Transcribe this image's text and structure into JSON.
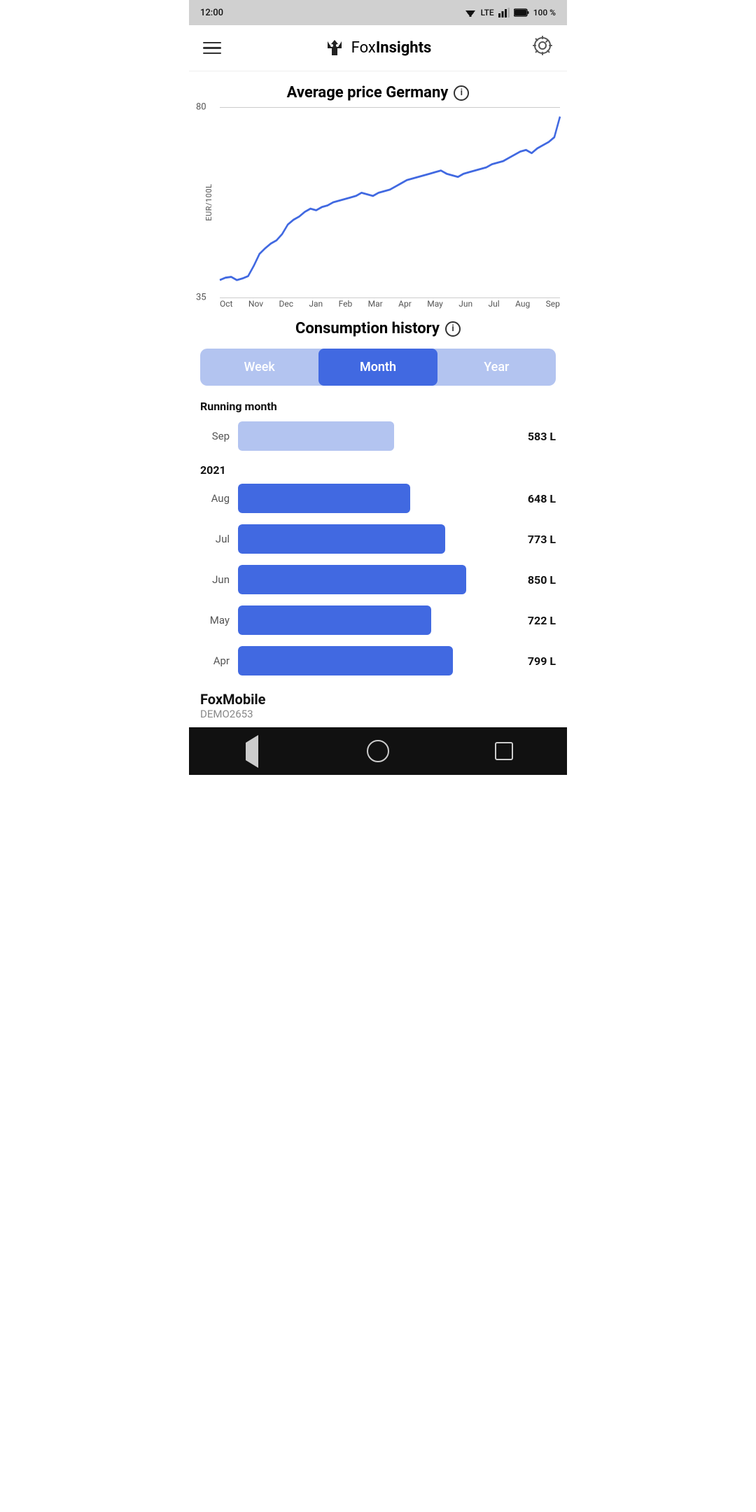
{
  "status_bar": {
    "time": "12:00",
    "signal": "LTE",
    "battery": "100 %"
  },
  "header": {
    "logo_text_light": "Fox",
    "logo_text_bold": "Insights",
    "hamburger_label": "Menu",
    "settings_label": "Settings"
  },
  "price_chart": {
    "title": "Average price Germany",
    "y_label": "EUR/100L",
    "y_min": 35,
    "y_max": 80,
    "x_labels": [
      "Oct",
      "Nov",
      "Dec",
      "Jan",
      "Feb",
      "Mar",
      "Apr",
      "May",
      "Jun",
      "Jul",
      "Aug",
      "Sep"
    ]
  },
  "consumption": {
    "title": "Consumption history",
    "tabs": [
      "Week",
      "Month",
      "Year"
    ],
    "active_tab": 1,
    "running_month_label": "Running month",
    "year_label": "2021",
    "bars": [
      {
        "month": "Sep",
        "value": 583,
        "unit": "L",
        "type": "current",
        "pct": 58
      },
      {
        "month": "Aug",
        "value": 648,
        "unit": "L",
        "type": "past",
        "pct": 64
      },
      {
        "month": "Jul",
        "value": 773,
        "unit": "L",
        "type": "past",
        "pct": 77
      },
      {
        "month": "Jun",
        "value": 850,
        "unit": "L",
        "type": "past",
        "pct": 85
      },
      {
        "month": "May",
        "value": 722,
        "unit": "L",
        "type": "past",
        "pct": 72
      },
      {
        "month": "Apr",
        "value": 799,
        "unit": "L",
        "type": "past",
        "pct": 80
      }
    ]
  },
  "footer": {
    "brand_name": "FoxMobile",
    "brand_sub": "DEMO2653"
  }
}
